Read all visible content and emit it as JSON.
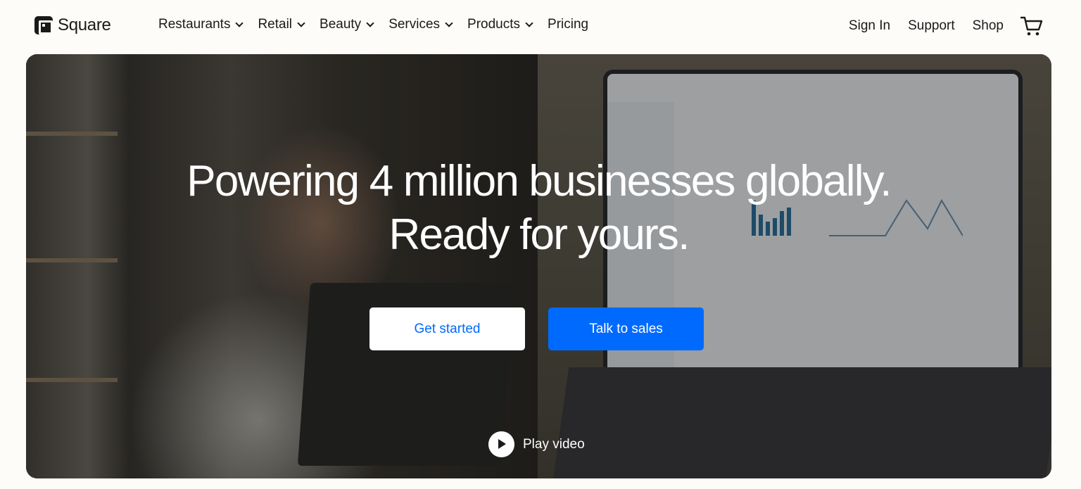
{
  "brand": {
    "name": "Square"
  },
  "nav": {
    "items": [
      {
        "label": "Restaurants",
        "dropdown": true
      },
      {
        "label": "Retail",
        "dropdown": true
      },
      {
        "label": "Beauty",
        "dropdown": true
      },
      {
        "label": "Services",
        "dropdown": true
      },
      {
        "label": "Products",
        "dropdown": true
      },
      {
        "label": "Pricing",
        "dropdown": false
      }
    ],
    "sign_in": "Sign In",
    "support": "Support",
    "shop": "Shop",
    "cart_icon": "cart-icon"
  },
  "hero": {
    "headline_line1": "Powering 4 million businesses globally.",
    "headline_line2": "Ready for yours.",
    "cta_primary": "Get started",
    "cta_secondary": "Talk to sales",
    "play_label": "Play video"
  },
  "colors": {
    "accent": "#006aff",
    "text": "#1a1a1a",
    "background": "#fdfcf9"
  }
}
